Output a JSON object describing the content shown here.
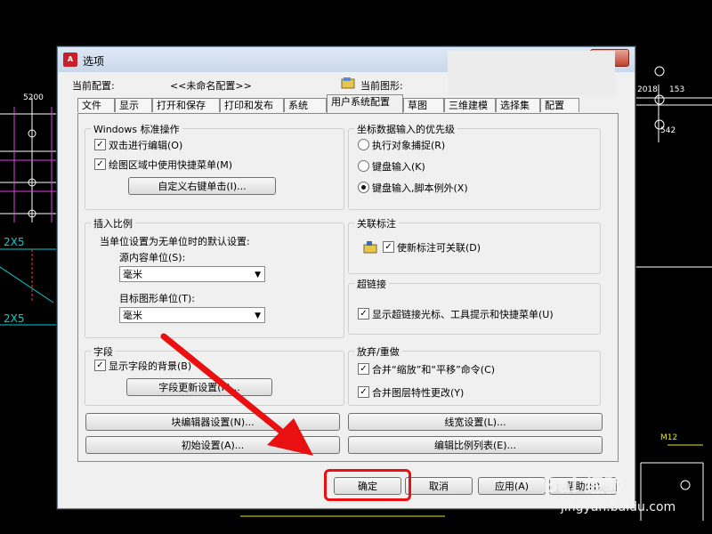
{
  "dialog": {
    "title": "选项",
    "close_label": "X",
    "current_profile_label": "当前配置:",
    "current_profile_value": "<<未命名配置>>",
    "current_drawing_label": "当前图形:"
  },
  "tabs": [
    "文件",
    "显示",
    "打开和保存",
    "打印和发布",
    "系统",
    "用户系统配置",
    "草图",
    "三维建模",
    "选择集",
    "配置"
  ],
  "windows_std": {
    "title": "Windows 标准操作",
    "dblclick_edit": "双击进行编辑(O)",
    "shortcut_menu": "绘图区域中使用快捷菜单(M)",
    "custom_right_click": "自定义右键单击(I)..."
  },
  "insert_scale": {
    "title": "插入比例",
    "desc": "当单位设置为无单位时的默认设置:",
    "source_label": "源内容单位(S):",
    "source_value": "毫米",
    "target_label": "目标图形单位(T):",
    "target_value": "毫米"
  },
  "fields": {
    "title": "字段",
    "show_bg": "显示字段的背景(B)",
    "update_settings": "字段更新设置(F)..."
  },
  "coord_input": {
    "title": "坐标数据输入的优先级",
    "opt1": "执行对象捕捉(R)",
    "opt2": "键盘输入(K)",
    "opt3": "键盘输入,脚本例外(X)"
  },
  "assoc_dim": {
    "title": "关联标注",
    "make_new": "使新标注可关联(D)"
  },
  "hyperlink": {
    "title": "超链接",
    "show": "显示超链接光标、工具提示和快捷菜单(U)"
  },
  "undo_redo": {
    "title": "放弃/重做",
    "combine_zoom": "合并“缩放”和“平移”命令(C)",
    "combine_layer": "合并图层特性更改(Y)"
  },
  "buttons": {
    "block_editor": "块编辑器设置(N)...",
    "lineweight": "线宽设置(L)...",
    "default_settings": "初始设置(A)...",
    "edit_scale_list": "编辑比例列表(E)...",
    "ok": "确定",
    "cancel": "取消",
    "apply": "应用(A)",
    "help": "帮助(H)"
  },
  "background": {
    "dims_left": [
      "5200",
      "2X5",
      "2X5"
    ],
    "dims_right": [
      "2018",
      "153",
      "542",
      "M12"
    ],
    "watermark_text": "Bai 经验",
    "watermark_url": "jingyan.baidu.com"
  },
  "colors": {
    "annotation_red": "#e81010",
    "cad_bg": "#000000"
  }
}
